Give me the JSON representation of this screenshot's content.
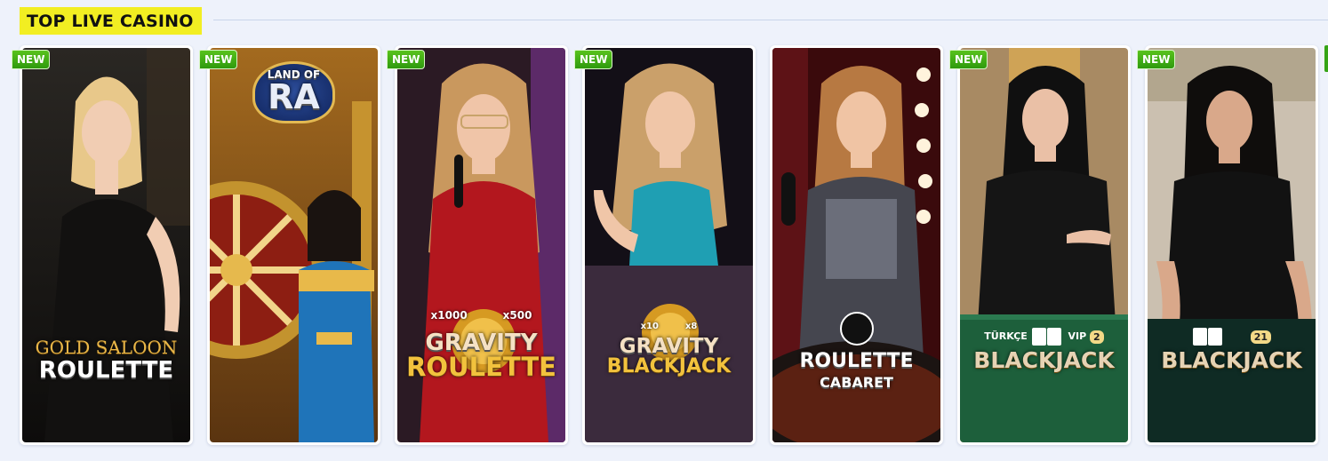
{
  "section": {
    "title": "TOP LIVE CASINO"
  },
  "badge_label": "NEW",
  "games": [
    {
      "badge": "NEW",
      "logo_line1": "GOLD SALOON",
      "logo_line2": "ROULETTE"
    },
    {
      "badge": "NEW",
      "logo_line1": "LAND OF",
      "logo_line2": "RA"
    },
    {
      "badge": "NEW",
      "logo_line1": "GRAVITY",
      "logo_line2": "ROULETTE",
      "mult_a": "x1000",
      "mult_b": "x500"
    },
    {
      "badge": "NEW",
      "logo_line1": "GRAVITY",
      "logo_line2": "BLACKJACK",
      "mult_a": "x10",
      "mult_b": "x8"
    },
    {
      "badge": "",
      "logo_line1": "ROULETTE",
      "logo_line2": "CABARET"
    },
    {
      "badge": "NEW",
      "logo_pre": "TÜRKÇE",
      "logo_vip": "VIP",
      "logo_num": "2",
      "logo_line2": "BLACKJACK"
    },
    {
      "badge": "NEW",
      "logo_num": "21",
      "logo_line2": "BLACKJACK"
    }
  ],
  "colors": {
    "title_bg": "#f2ee22",
    "badge_green": "#3aa815",
    "page_bg": "#eef2fb"
  }
}
